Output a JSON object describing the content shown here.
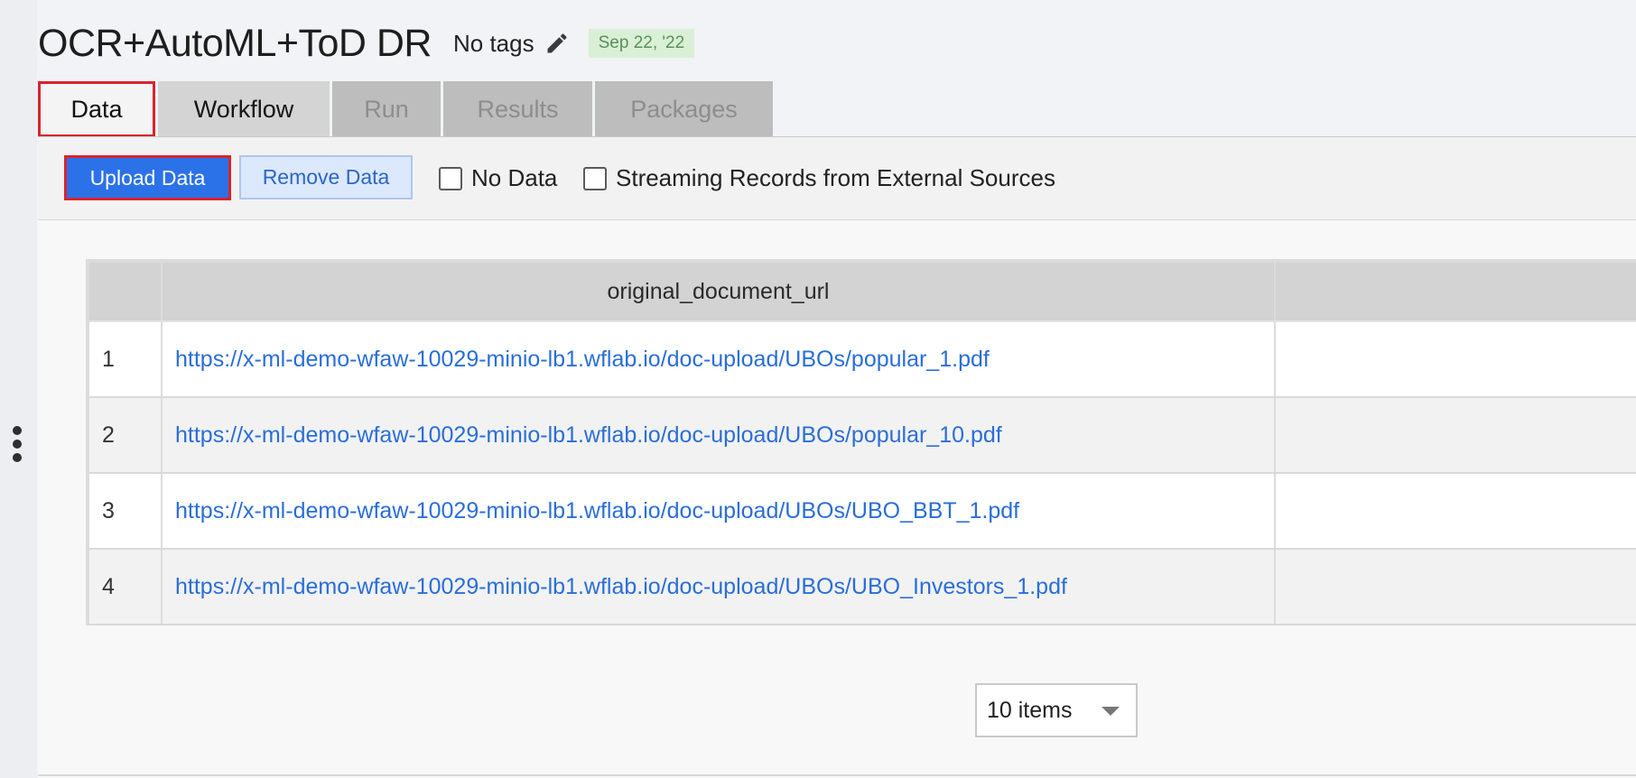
{
  "header": {
    "title": "OCR+AutoML+ToD DR",
    "tags": "No tags",
    "date_badge": "Sep 22, '22",
    "edit_icon": "pencil-icon"
  },
  "tabs": [
    {
      "label": "Data",
      "state": "active"
    },
    {
      "label": "Workflow",
      "state": "enabled"
    },
    {
      "label": "Run",
      "state": "disabled"
    },
    {
      "label": "Results",
      "state": "disabled"
    },
    {
      "label": "Packages",
      "state": "disabled"
    }
  ],
  "toolbar": {
    "upload_label": "Upload Data",
    "remove_label": "Remove Data",
    "no_data_label": "No Data",
    "no_data_checked": false,
    "streaming_label": "Streaming Records from External Sources",
    "streaming_checked": false
  },
  "table": {
    "columns": [
      "",
      "original_document_url",
      ""
    ],
    "rows": [
      {
        "index": "1",
        "url": "https://x-ml-demo-wfaw-10029-minio-lb1.wflab.io/doc-upload/UBOs/popular_1.pdf"
      },
      {
        "index": "2",
        "url": "https://x-ml-demo-wfaw-10029-minio-lb1.wflab.io/doc-upload/UBOs/popular_10.pdf"
      },
      {
        "index": "3",
        "url": "https://x-ml-demo-wfaw-10029-minio-lb1.wflab.io/doc-upload/UBOs/UBO_BBT_1.pdf"
      },
      {
        "index": "4",
        "url": "https://x-ml-demo-wfaw-10029-minio-lb1.wflab.io/doc-upload/UBOs/UBO_Investors_1.pdf"
      }
    ]
  },
  "pager": {
    "page_size_label": "10 items"
  },
  "side_menu_icon": "more-vertical-icon",
  "colors": {
    "accent": "#2b72e8",
    "highlight_outline": "#d9232e",
    "link": "#2a6ed8",
    "badge_bg": "#d9efd6",
    "badge_text": "#5b8f5b"
  }
}
